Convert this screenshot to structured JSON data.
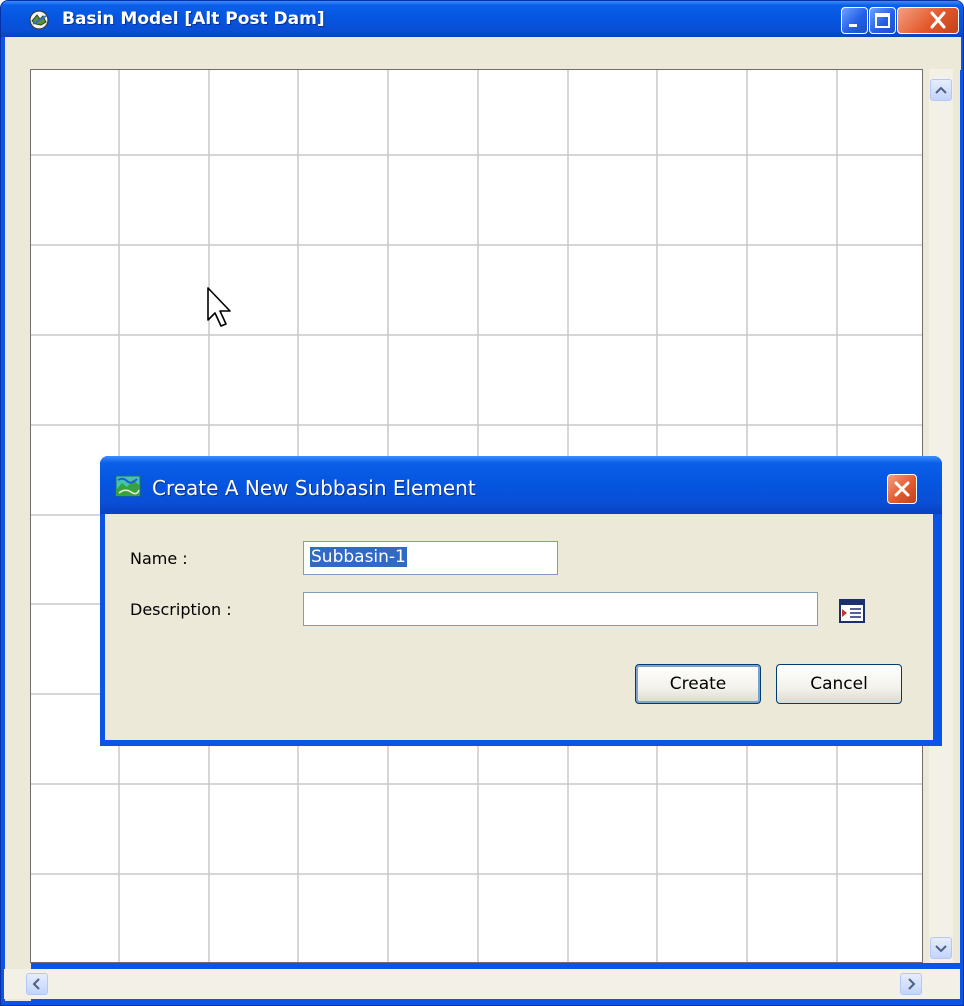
{
  "window": {
    "title": "Basin Model [Alt Post Dam]",
    "icon": "basin-model-icon",
    "buttons": [
      "minimize",
      "maximize",
      "close"
    ]
  },
  "canvas": {
    "grid": true,
    "grid_color": "#c8c8c8"
  },
  "dialog": {
    "title": "Create A New Subbasin Element",
    "icon": "subbasin-icon",
    "name_label": "Name :",
    "name_value": "Subbasin-1",
    "description_label": "Description :",
    "description_value": "",
    "description_button_icon": "text-editor-icon",
    "create_label": "Create",
    "cancel_label": "Cancel"
  },
  "colors": {
    "titlebar": "#0556e0",
    "dialog_body": "#ece9d8",
    "selection": "#316ac5",
    "close_button": "#e35a2c"
  }
}
